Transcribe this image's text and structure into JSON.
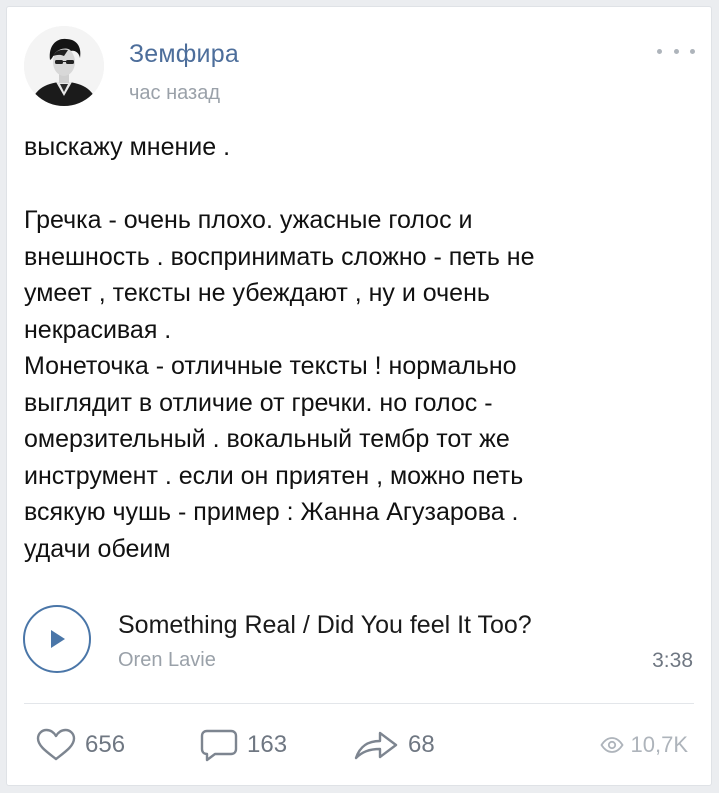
{
  "post": {
    "author": "Земфира",
    "time": "час назад",
    "text": "выскажу мнение .\n\nГречка - очень плохо. ужасные голос и\nвнешность . воспринимать сложно - петь не\nумеет , тексты не убеждают , ну и очень\nнекрасивая .\nМонеточка - отличные тексты ! нормально\nвыглядит в отличие от гречки. но голос -\nомерзительный . вокальный тембр тот же\nинструмент . если он приятен , можно петь\nвсякую чушь - пример : Жанна Агузарова .\nудачи обеим"
  },
  "audio": {
    "title": "Something Real / Did You feel It Too?",
    "artist": "Oren Lavie",
    "duration": "3:38"
  },
  "actions": {
    "likes": "656",
    "comments": "163",
    "shares": "68",
    "views": "10,7K"
  },
  "icons": {
    "more": "more-dots-icon",
    "play": "play-icon",
    "like": "heart-icon",
    "comment": "comment-icon",
    "share": "share-arrow-icon",
    "views": "eye-icon"
  },
  "colors": {
    "accent": "#4a76a8",
    "author_link": "#4d6e9b",
    "muted": "#9aa1a9",
    "icon": "#6f7782"
  }
}
